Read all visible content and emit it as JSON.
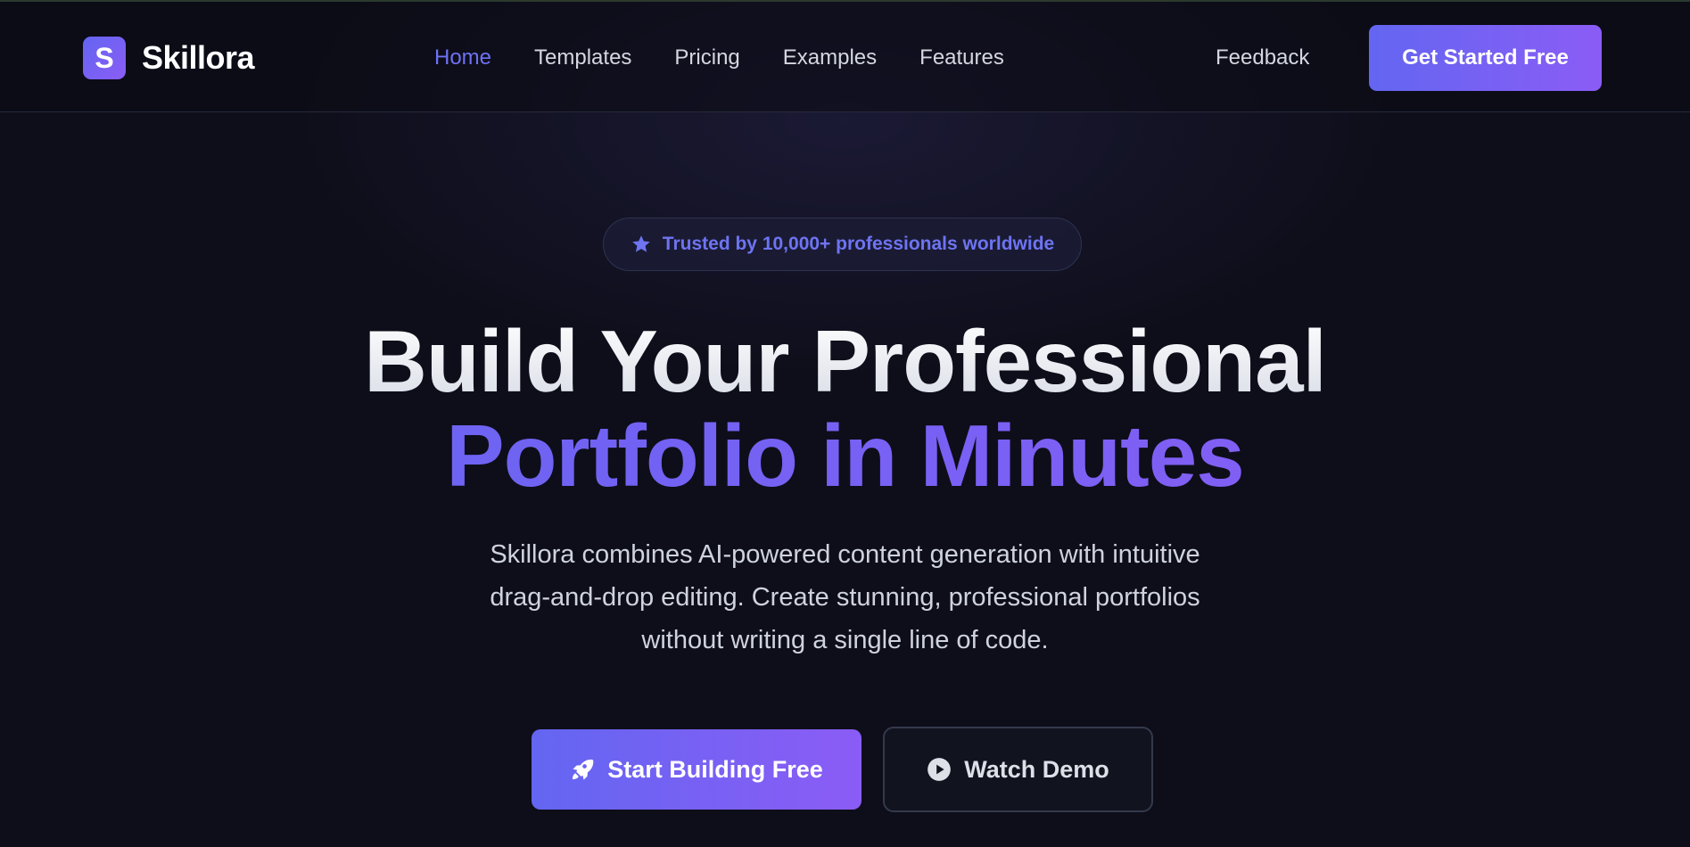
{
  "header": {
    "logo": {
      "mark": "S",
      "name": "Skillora"
    },
    "nav": [
      {
        "label": "Home",
        "active": true
      },
      {
        "label": "Templates",
        "active": false
      },
      {
        "label": "Pricing",
        "active": false
      },
      {
        "label": "Examples",
        "active": false
      },
      {
        "label": "Features",
        "active": false
      }
    ],
    "feedback_label": "Feedback",
    "cta_label": "Get Started Free"
  },
  "hero": {
    "badge": {
      "icon": "star-icon",
      "text": "Trusted by 10,000+ professionals worldwide"
    },
    "headline_line1": "Build Your Professional",
    "headline_line2": "Portfolio in Minutes",
    "subtitle_lines": [
      "Skillora combines AI-powered content generation with intuitive",
      "drag-and-drop editing. Create stunning, professional portfolios",
      "without writing a single line of code."
    ],
    "primary_button": {
      "icon": "rocket-icon",
      "label": "Start Building Free"
    },
    "secondary_button": {
      "icon": "play-circle-icon",
      "label": "Watch Demo"
    }
  },
  "colors": {
    "background": "#0e0e1a",
    "accent_start": "#6366f1",
    "accent_end": "#8b5cf6",
    "nav_active": "#6d72f3",
    "text_primary": "#eceef3",
    "text_muted": "#cfd3dc"
  }
}
